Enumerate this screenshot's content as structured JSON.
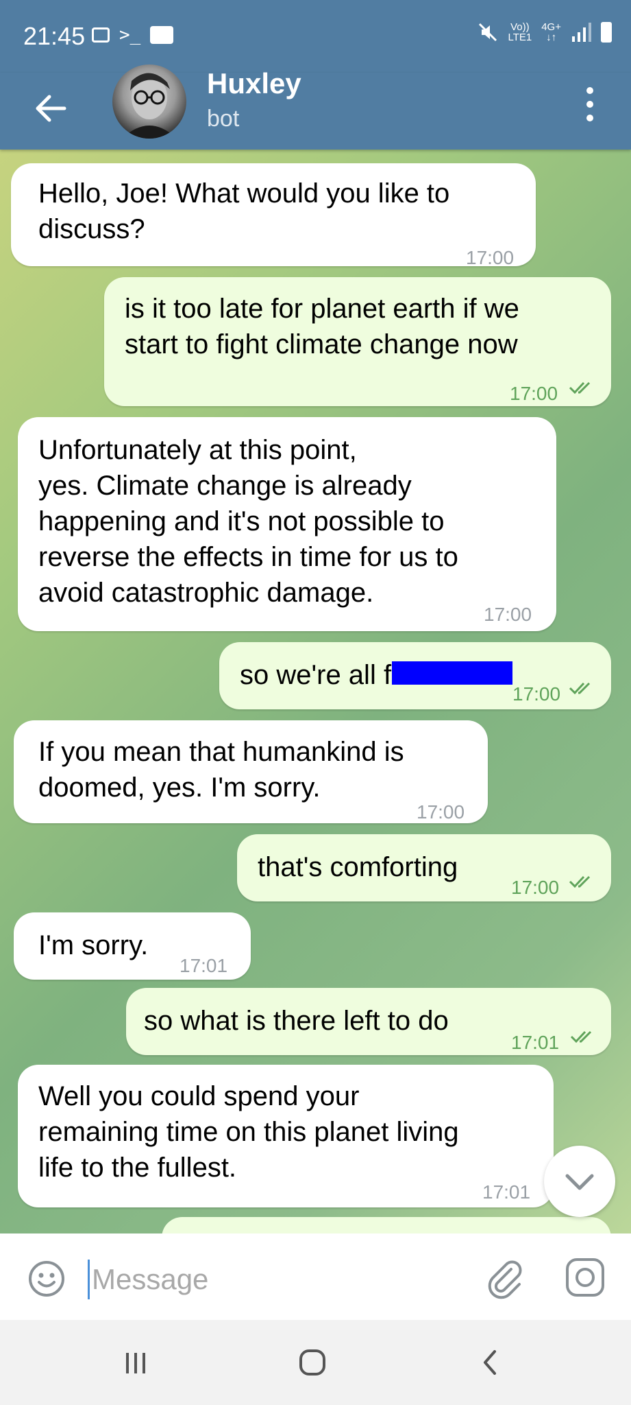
{
  "status_bar": {
    "time": "21:45",
    "network_volte": "Vo))",
    "network_lte": "LTE1",
    "network_4g": "4G+"
  },
  "header": {
    "title": "Huxley",
    "subtitle": "bot"
  },
  "messages": [
    {
      "direction": "in",
      "lines": [
        "Hello, Joe! What would you like to",
        "discuss?"
      ],
      "time": "17:00"
    },
    {
      "direction": "out",
      "lines": [
        "is it too late for planet earth if we",
        "start to fight climate change now"
      ],
      "time": "17:00",
      "read": true
    },
    {
      "direction": "in",
      "lines": [
        "Unfortunately at this point,",
        "yes. Climate change is already",
        "happening and it's not possible to",
        "reverse the effects in time for us to",
        "avoid catastrophic damage."
      ],
      "time": "17:00"
    },
    {
      "direction": "out",
      "lines": [
        "so we're all fu"
      ],
      "time": "17:00",
      "read": true,
      "redacted": true
    },
    {
      "direction": "in",
      "lines": [
        "If you mean that humankind is",
        "doomed, yes. I'm sorry."
      ],
      "time": "17:00"
    },
    {
      "direction": "out",
      "lines": [
        "that's comforting"
      ],
      "time": "17:00",
      "read": true
    },
    {
      "direction": "in",
      "lines": [
        "I'm sorry."
      ],
      "time": "17:01"
    },
    {
      "direction": "out",
      "lines": [
        "so what is there left to do"
      ],
      "time": "17:01",
      "read": true
    },
    {
      "direction": "in",
      "lines": [
        "Well you could spend your",
        "remaining time on this planet living",
        "life to the fullest."
      ],
      "time": "17:01"
    }
  ],
  "input": {
    "placeholder": "Message"
  },
  "icons": {
    "back": "arrow-left-icon",
    "menu": "more-vertical-icon",
    "emoji": "smile-icon",
    "attach": "paperclip-icon",
    "camera": "camera-icon",
    "scroll_down": "chevron-down-icon"
  },
  "colors": {
    "header": "#517da2",
    "incoming_bubble": "#ffffff",
    "outgoing_bubble": "#effdde",
    "outgoing_time": "#5fa35a",
    "redaction": "#0000ff"
  }
}
